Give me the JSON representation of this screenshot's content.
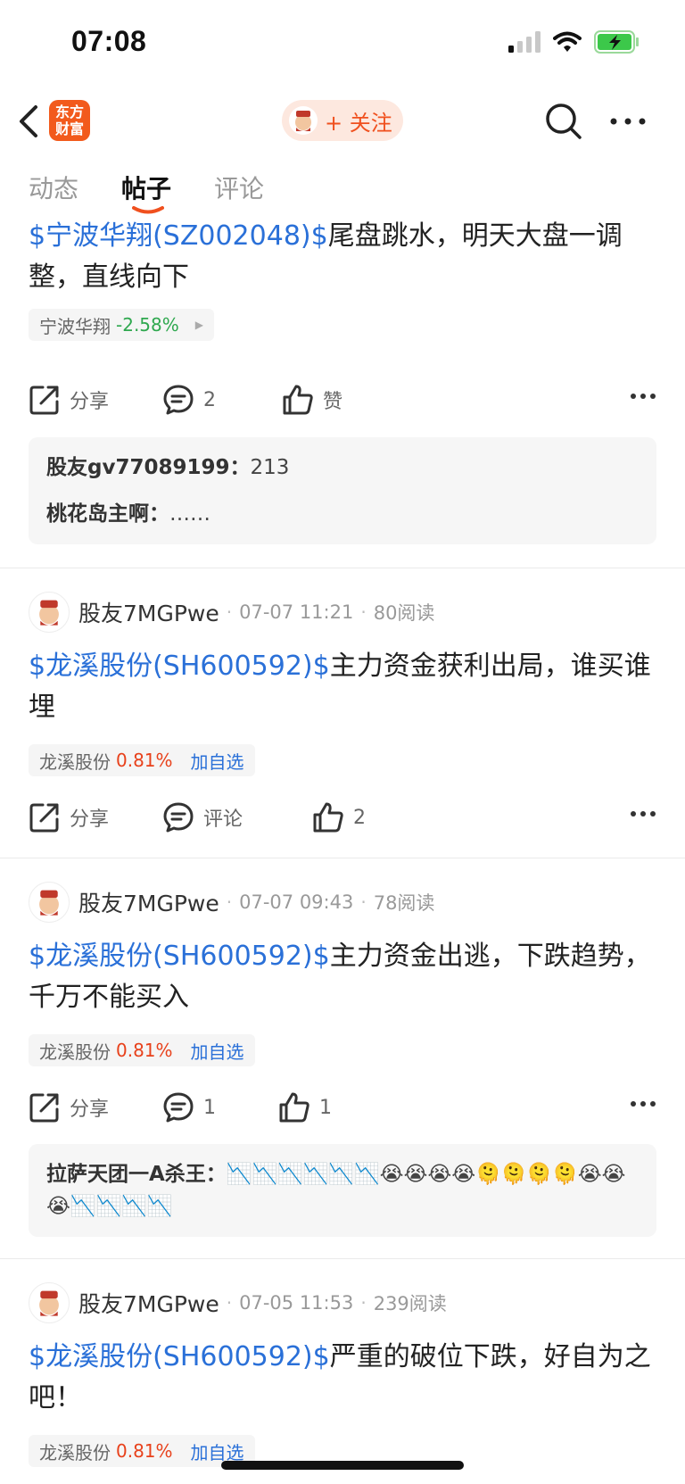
{
  "status": {
    "time": "07:08"
  },
  "nav": {
    "logo_text_1": "东方",
    "logo_text_2": "财富",
    "follow_label": "+ 关注"
  },
  "tabs": [
    {
      "label": "动态"
    },
    {
      "label": "帖子"
    },
    {
      "label": "评论"
    }
  ],
  "posts": [
    {
      "stock_code": "$宁波华翔(SZ002048)$",
      "text": "尾盘跳水，明天大盘一调整，直线向下",
      "tag_name": "宁波华翔",
      "tag_change": "-2.58%",
      "share_label": "分享",
      "comment_label": "2",
      "like_label": "赞",
      "comments": [
        {
          "user": "股友gv77089199：",
          "text": "213"
        },
        {
          "user": "桃花岛主啊：",
          "text": "……"
        }
      ]
    },
    {
      "author": "股友7MGPwe",
      "time": "07-07 11:21",
      "reads": "80阅读",
      "stock_code": "$龙溪股份(SH600592)$",
      "text": "主力资金获利出局，谁买谁埋",
      "tag_name": "龙溪股份",
      "tag_change": "0.81%",
      "tag_action": "加自选",
      "share_label": "分享",
      "comment_label": "评论",
      "like_label": "2"
    },
    {
      "author": "股友7MGPwe",
      "time": "07-07 09:43",
      "reads": "78阅读",
      "stock_code": "$龙溪股份(SH600592)$",
      "text": "主力资金出逃，下跌趋势，千万不能买入",
      "tag_name": "龙溪股份",
      "tag_change": "0.81%",
      "tag_action": "加自选",
      "share_label": "分享",
      "comment_label": "1",
      "like_label": "1",
      "comments": [
        {
          "user": "拉萨天团一A杀王：",
          "text": "📉📉📉📉📉📉😭😭😭😭🫠🫠🫠🫠😭😭😭📉📉📉📉"
        }
      ]
    },
    {
      "author": "股友7MGPwe",
      "time": "07-05 11:53",
      "reads": "239阅读",
      "stock_code": "$龙溪股份(SH600592)$",
      "text": "严重的破位下跌，好自为之吧！",
      "tag_name": "龙溪股份",
      "tag_change": "0.81%",
      "tag_action": "加自选"
    }
  ],
  "colors": {
    "accent": "#f0501e",
    "link": "#2a70d8",
    "down": "#2fa84f",
    "up": "#e8411b"
  }
}
